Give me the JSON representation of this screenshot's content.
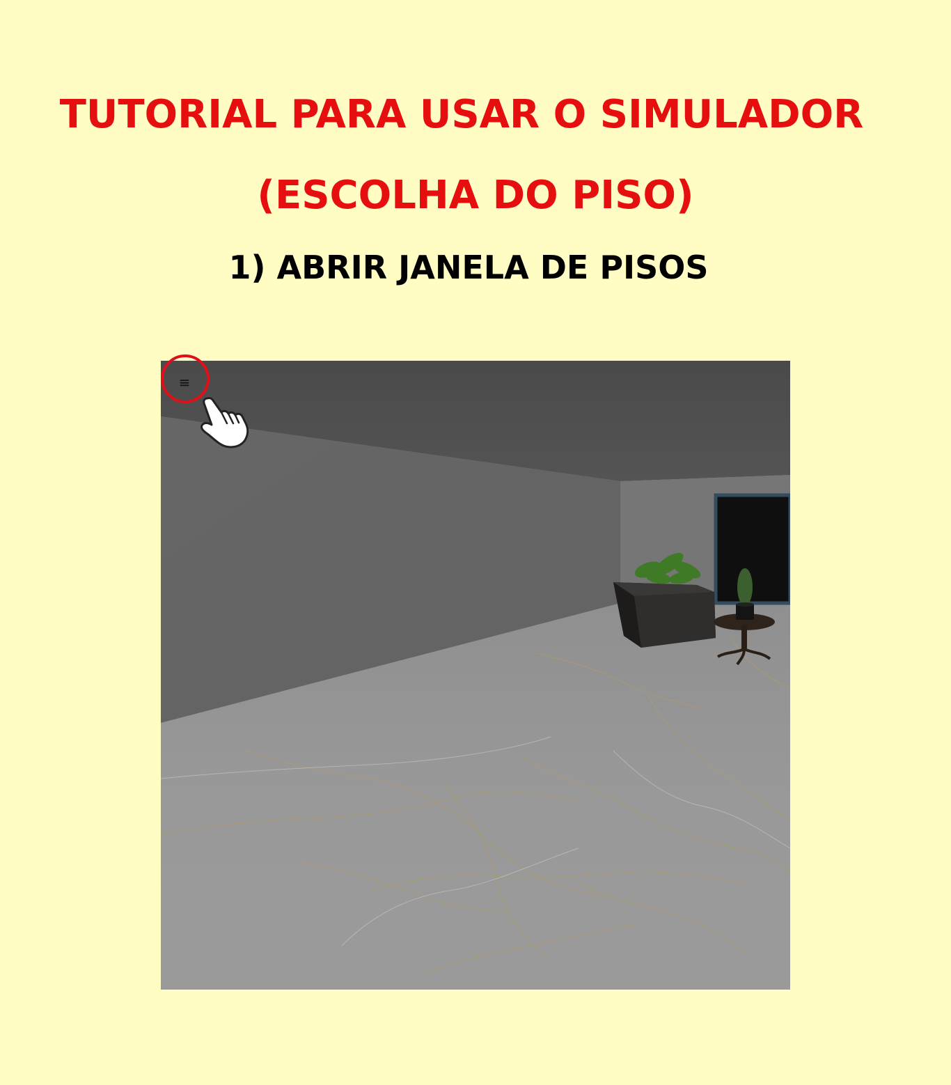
{
  "heading": {
    "title_line1": "TUTORIAL PARA USAR O SIMULADOR",
    "title_line2": "(ESCOLHA DO PISO)",
    "step": "1) ABRIR JANELA DE PISOS"
  },
  "viewer": {
    "menu_button_icon": "hamburger-menu-icon",
    "menu_button_glyph": "≡",
    "pointer_icon": "pointing-hand-icon"
  },
  "colors": {
    "background": "#fffcc4",
    "title": "#e60f0f",
    "step": "#000000",
    "highlight": "#e0101a"
  }
}
